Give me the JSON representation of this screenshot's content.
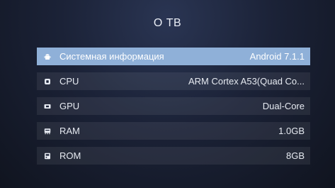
{
  "header": {
    "title": "О ТВ"
  },
  "rows": [
    {
      "icon": "android-icon",
      "label": "Системная информация",
      "value": "Android 7.1.1",
      "selected": true
    },
    {
      "icon": "cpu-chip-icon",
      "label": "CPU",
      "value": "ARM Cortex A53(Quad Co...",
      "selected": false
    },
    {
      "icon": "gpu-card-icon",
      "label": "GPU",
      "value": "Dual-Core",
      "selected": false
    },
    {
      "icon": "ram-memory-icon",
      "label": "RAM",
      "value": "1.0GB",
      "selected": false
    },
    {
      "icon": "rom-storage-icon",
      "label": "ROM",
      "value": "8GB",
      "selected": false
    }
  ],
  "colors": {
    "selected_row": "#8fb0d8",
    "row_bg": "rgba(255,255,255,0.07)"
  }
}
